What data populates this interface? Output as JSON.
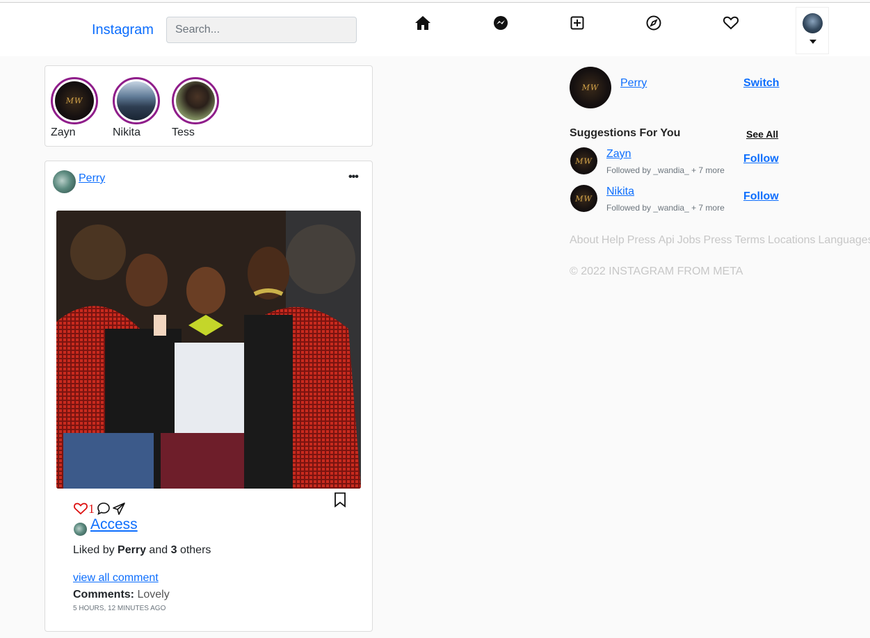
{
  "navbar": {
    "brand": "Instagram",
    "search_placeholder": "Search...",
    "icons": [
      "home-icon",
      "messenger-icon",
      "new-post-icon",
      "explore-icon",
      "activity-heart-icon"
    ]
  },
  "stories": [
    {
      "name": "Zayn"
    },
    {
      "name": "Nikita"
    },
    {
      "name": "Tess"
    }
  ],
  "post": {
    "username": "Perry",
    "like_count": "1",
    "caption_title": "Access",
    "liked_by_prefix": "Liked by",
    "liked_by_user": "Perry",
    "liked_by_and": "and",
    "liked_by_count": "3",
    "liked_by_suffix": "others",
    "view_all": "view all comment",
    "comments_label": "Comments:",
    "comment_text": "Lovely",
    "time_ago": "5 HOURS, 12 MINUTES AGO"
  },
  "sidebar": {
    "username": "Perry",
    "switch_label": "Switch",
    "suggestions_title": "Suggestions For You",
    "see_all": "See All",
    "suggestions": [
      {
        "name": "Zayn",
        "sub": "Followed by _wandia_ + 7 more",
        "action": "Follow"
      },
      {
        "name": "Nikita",
        "sub": "Followed by _wandia_ + 7 more",
        "action": "Follow"
      }
    ],
    "footer_links": [
      "About",
      "Help",
      "Press",
      "Api",
      "Jobs",
      "Press",
      "Terms",
      "Locations",
      "Languages"
    ],
    "copyright": "© 2022 INSTAGRAM FROM META"
  },
  "colors": {
    "link": "#0d6efd",
    "story_ring": "#8f1d8a",
    "like": "#dd1111"
  }
}
